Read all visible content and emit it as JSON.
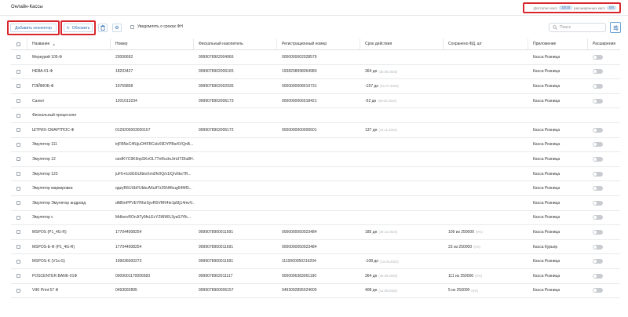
{
  "header": {
    "title": "Онлайн-Кассы",
    "licenses": {
      "available_label": "Доступно касс",
      "available_value": "15/15",
      "extensions_label": "расширенных касс",
      "extensions_value": "0/0"
    }
  },
  "toolbar": {
    "add_connector_label": "Добавить коннектор",
    "refresh_label": "Обновить",
    "notify_label": "Уведомлять о сроках ФН",
    "search_placeholder": "Поиск"
  },
  "columns": {
    "name": "Название",
    "number": "Номер",
    "fn": "Фискальный накопитель",
    "reg": "Регистрационный номер",
    "expiry": "Срок действия",
    "saved": "Сохранено ФД, шт",
    "app": "Приложение",
    "ext": "Расширения"
  },
  "rows": [
    {
      "name": "Меркурий 105-Ф",
      "number": "23000692",
      "fn": "9999078902004966",
      "reg": "0000000002028579",
      "expiry": "",
      "expiry_date": "",
      "saved": "",
      "saved_pct": "",
      "app": "Касса Розница",
      "toggle": true
    },
    {
      "name": "НЕВА-01-Ф",
      "number": "18203427",
      "fn": "9999078902006165",
      "reg": "1938208998064980",
      "expiry": "364 дн",
      "expiry_date": "(26.08.2025)",
      "saved": "",
      "saved_pct": "",
      "app": "Касса Розница",
      "toggle": true
    },
    {
      "name": "ПЭЙМОБ-Ф",
      "number": "19769858",
      "fn": "9999078902002936",
      "reg": "0000000008019731",
      "expiry": "-157 дн",
      "expiry_date": "(21.07.2023)",
      "saved": "",
      "saved_pct": "",
      "app": "Касса Розница",
      "toggle": true
    },
    {
      "name": "Салют",
      "number": "1201013234",
      "fn": "9999078902006173",
      "reg": "0000000006018421",
      "expiry": "-52 дн",
      "expiry_date": "(09.03.2024)",
      "saved": "",
      "saved_pct": "",
      "app": "Касса Розница",
      "toggle": true
    },
    {
      "name": "Фискальный процессинг",
      "number": "",
      "fn": "",
      "reg": "",
      "expiry": "",
      "expiry_date": "",
      "saved": "",
      "saved_pct": "",
      "app": "",
      "toggle": false
    },
    {
      "name": "ШТРИХ-СМАРТПОС-Ф",
      "number": "0129200003000167",
      "fn": "9999078902006172",
      "reg": "0000000000006501",
      "expiry": "137 дн",
      "expiry_date": "(12.11.2024)",
      "saved": "",
      "saved_pct": "",
      "app": "Касса Розница",
      "toggle": true
    },
    {
      "name": "Эмулятор 111",
      "number": "trjFBNxC4fUjuOHFRCxbX9DYPBsr5VQnB...",
      "fn": "",
      "reg": "",
      "expiry": "",
      "expiry_date": "",
      "saved": "",
      "saved_pct": "",
      "app": "Касса Розница",
      "toggle": true
    },
    {
      "name": "Эмулятор 12",
      "number": "ozsfKYC9K9npSKvOL7TnRcztnJmUTDIu8H...",
      "fn": "",
      "reg": "",
      "expiry": "",
      "expiry_date": "",
      "saved": "",
      "saved_pct": "",
      "app": "Касса Розница",
      "toggle": true
    },
    {
      "name": "Эмулятор 123",
      "number": "juF6+/c/dGGUIbtvXmi2fv0Q/x1/Q/v6ksTR...",
      "fn": "",
      "reg": "",
      "expiry": "",
      "expiry_date": "",
      "saved": "",
      "saved_pct": "",
      "app": "Касса Розница",
      "toggle": true
    },
    {
      "name": "Эмулятор маркировка",
      "number": "qqzyR6UUbFUbbcA6uIf7z25NHbug54Mf3...",
      "fn": "",
      "reg": "",
      "expiry": "",
      "expiry_date": "",
      "saved": "",
      "saved_pct": "",
      "app": "Касса Розница",
      "toggle": true
    },
    {
      "name": "Эмулятор Эмулятор андроид",
      "number": "dABmPPVEYRheSyvR6VRR4Ie1p6Ij14mvV...",
      "fn": "",
      "reg": "",
      "expiry": "",
      "expiry_date": "",
      "saved": "",
      "saved_pct": "",
      "app": "Касса Розница",
      "toggle": true
    },
    {
      "name": "Эмулятор с",
      "number": "MdbvrvROnJtTy9fsLEcYZtNWIL3ya0JYlk...",
      "fn": "",
      "reg": "",
      "expiry": "",
      "expiry_date": "",
      "saved": "",
      "saved_pct": "",
      "app": "Касса Розница",
      "toggle": true
    },
    {
      "name": "MSPOS (Р1_4G-R)",
      "number": "177044008254",
      "fn": "9999078900011691",
      "reg": "0000000050023484",
      "expiry": "185 дн",
      "expiry_date": "(30.12.2024)",
      "saved": "109 из 250000",
      "saved_pct": "(0%)",
      "app": "Касса Розница",
      "toggle": true
    },
    {
      "name": "MSPOS-E-Ф (Р1_4G-R)",
      "number": "177044008254",
      "fn": "9999078900011691",
      "reg": "0000000050023484",
      "expiry": "",
      "expiry_date": "",
      "saved": "23 из 250000",
      "saved_pct": "(0%)",
      "app": "Касса Курьер",
      "toggle": true
    },
    {
      "name": "MSPOS-K (V1s-G)",
      "number": "199036000273",
      "fn": "9999078900011691",
      "reg": "1110000050216204",
      "expiry": "-108 дн",
      "expiry_date": "(13.05.2024)",
      "saved": "",
      "saved_pct": "",
      "app": "Касса Розница",
      "toggle": true
    },
    {
      "name": "POSCENTER BANK-01Ф",
      "number": "0000001170006583",
      "fn": "9999078902011117",
      "reg": "0000006383061190",
      "expiry": "364 дн",
      "expiry_date": "(26.08.2025)",
      "saved": "111 из 250000",
      "saved_pct": "(0%)",
      "app": "Касса Розница",
      "toggle": true
    },
    {
      "name": "VIKI Print 57 Ф",
      "number": "0493092895",
      "fn": "9999078900006157",
      "reg": "0493092895024605",
      "expiry": "408 дн",
      "expiry_date": "(11.08.2025)",
      "saved": "5 из 250000",
      "saved_pct": "(0%)",
      "app": "Касса Розница",
      "toggle": true
    }
  ]
}
